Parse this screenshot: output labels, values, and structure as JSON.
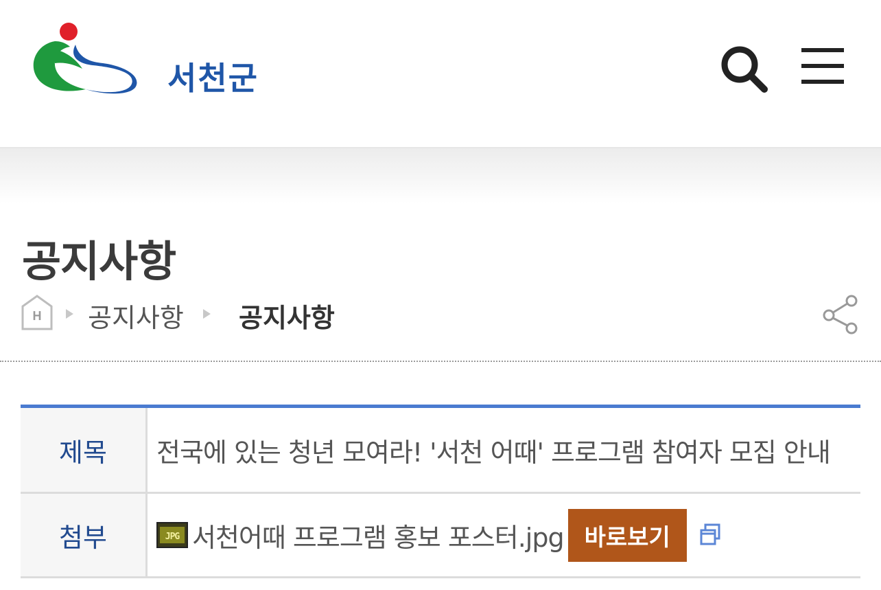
{
  "header": {
    "logo_text": "서천군",
    "icons": [
      "search-icon",
      "hamburger-menu-icon"
    ]
  },
  "page": {
    "title": "공지사항"
  },
  "breadcrumb": {
    "home_icon": "home-icon",
    "items": [
      "공지사항",
      "공지사항"
    ],
    "share_icon": "share-icon"
  },
  "detail": {
    "title_label": "제목",
    "title_value": "전국에 있는 청년 모여라! '서천 어때' 프로그램 참여자 모집 안내",
    "attach_label": "첨부",
    "attachment": {
      "file_icon": "jpg-file-icon",
      "filename": "서천어때 프로그램 홍보 포스터.jpg",
      "view_button": "바로보기",
      "new_window_icon": "new-window-icon"
    }
  },
  "colors": {
    "accent_blue": "#4a7bd0",
    "label_blue": "#214a8f",
    "view_button": "#b0561a",
    "logo_green": "#1f9a3e",
    "logo_blue": "#1f56a8",
    "logo_red": "#e0202a"
  }
}
